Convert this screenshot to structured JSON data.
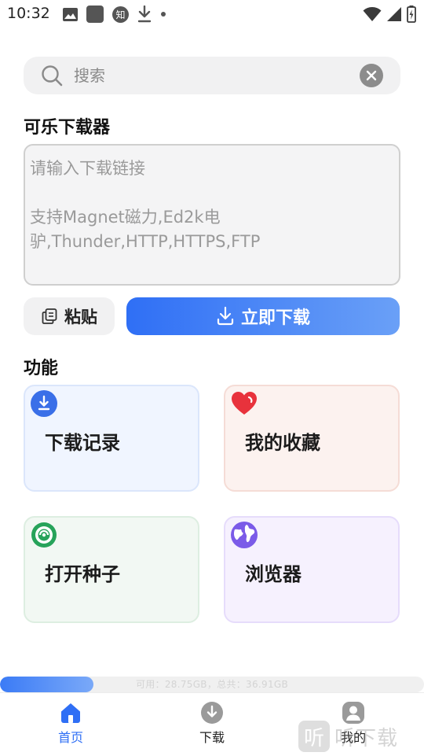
{
  "status_bar": {
    "time": "10:32",
    "notification_icons": [
      "image-icon",
      "app-square-icon",
      "zhihu-icon",
      "download-arrow-icon",
      "dot-icon"
    ],
    "system_icons": [
      "wifi-icon",
      "signal-icon",
      "battery-charging-icon"
    ],
    "zhihu_glyph": "知"
  },
  "search": {
    "placeholder": "搜索",
    "value": ""
  },
  "app_title": "可乐下载器",
  "link_input": {
    "placeholder": "请输入下载链接\n\n支持Magnet磁力,Ed2k电驴,Thunder,HTTP,HTTPS,FTP",
    "value": ""
  },
  "actions": {
    "paste_label": "粘贴",
    "download_label": "立即下载"
  },
  "features": {
    "title": "功能",
    "items": [
      {
        "label": "下载记录",
        "icon": "download-circle-icon"
      },
      {
        "label": "我的收藏",
        "icon": "heart-icon"
      },
      {
        "label": "打开种子",
        "icon": "torrent-icon"
      },
      {
        "label": "浏览器",
        "icon": "globe-icon"
      }
    ]
  },
  "storage": {
    "text": "可用：28.75GB，总共：36.91GB",
    "used_fraction": 0.22
  },
  "bottom_nav": {
    "items": [
      {
        "label": "首页",
        "icon": "home-icon",
        "active": true
      },
      {
        "label": "下载",
        "icon": "download-icon",
        "active": false
      },
      {
        "label": "我的",
        "icon": "user-icon",
        "active": false
      }
    ]
  },
  "watermark": {
    "badge": "听",
    "text": "听下载"
  },
  "colors": {
    "accent": "#2f6ff5",
    "accent_light": "#6aa0f7"
  }
}
